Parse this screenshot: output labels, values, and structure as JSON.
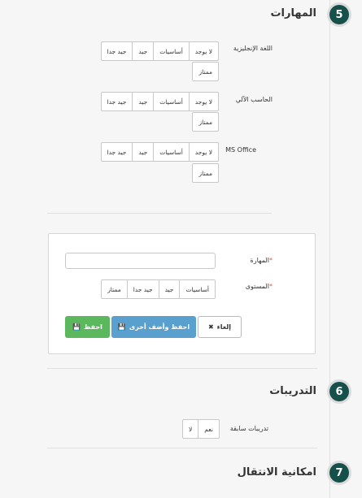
{
  "sections": {
    "skills": {
      "number": "5",
      "title": "المهارات"
    },
    "trainings": {
      "number": "6",
      "title": "التدريبات"
    },
    "mobility": {
      "number": "7",
      "title": "امكانية الانتقال"
    }
  },
  "skill_rows": [
    {
      "label": "اللغة الإنجليزية",
      "options": [
        "لا يوجد",
        "أساسيات",
        "جيد",
        "جيد جدا"
      ],
      "extra": "ممتاز"
    },
    {
      "label": "الحاسب الآلي",
      "options": [
        "لا يوجد",
        "أساسيات",
        "جيد",
        "جيد جدا"
      ],
      "extra": "ممتاز"
    },
    {
      "label": "MS Office",
      "options": [
        "لا يوجد",
        "أساسيات",
        "جيد",
        "جيد جدا"
      ],
      "extra": "ممتاز"
    }
  ],
  "form": {
    "skill_label": "المهارة",
    "level_label": "المستوى",
    "required_mark": "*",
    "skill_value": "",
    "levels": [
      "أساسيات",
      "جيد",
      "جيد جدا",
      "ممتاز"
    ],
    "save_label": "احفظ",
    "save_add_label": "احفظ وأضف أخرى",
    "cancel_label": "إلغاء"
  },
  "trainings": {
    "question_label": "تدريبات سابقة",
    "yes": "نعم",
    "no": "لا"
  },
  "colors": {
    "badge": "#16504a",
    "save": "#5cb85c",
    "save_add": "#5aa0cf",
    "required": "#d9534f"
  }
}
